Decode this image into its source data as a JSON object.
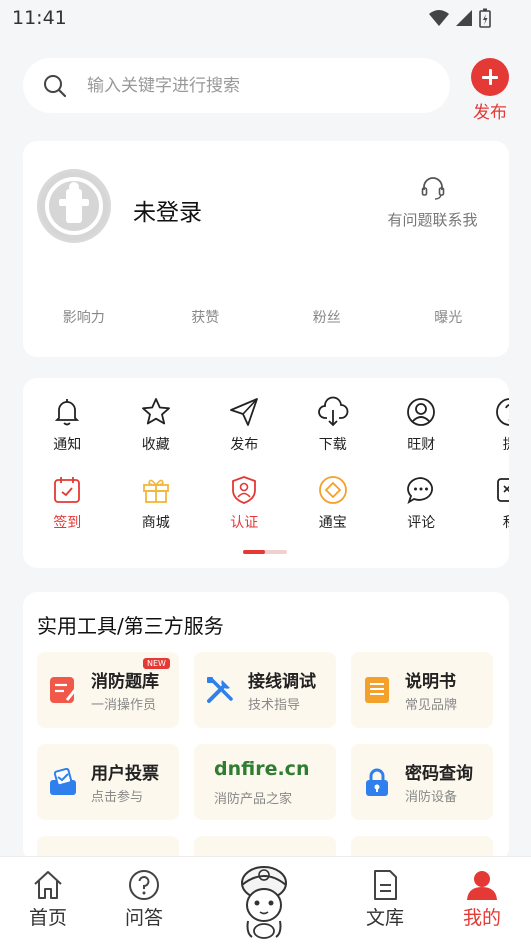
{
  "status_bar": {
    "time": "11:41"
  },
  "search": {
    "placeholder": "输入关键字进行搜索"
  },
  "publish": {
    "label": "发布"
  },
  "profile": {
    "login_text": "未登录",
    "help_text": "有问题联系我",
    "stats": [
      "影响力",
      "获赞",
      "粉丝",
      "曝光"
    ]
  },
  "features": {
    "row1": [
      {
        "label": "通知",
        "icon": "bell-icon"
      },
      {
        "label": "收藏",
        "icon": "star-icon"
      },
      {
        "label": "发布",
        "icon": "send-icon"
      },
      {
        "label": "下载",
        "icon": "cloud-download-icon"
      },
      {
        "label": "旺财",
        "icon": "user-circle-icon"
      },
      {
        "label": "提",
        "icon": "question-icon"
      }
    ],
    "row2": [
      {
        "label": "签到",
        "icon": "calendar-check-icon"
      },
      {
        "label": "商城",
        "icon": "gift-icon"
      },
      {
        "label": "认证",
        "icon": "shield-user-icon"
      },
      {
        "label": "通宝",
        "icon": "coin-icon"
      },
      {
        "label": "评论",
        "icon": "comment-icon"
      },
      {
        "label": "私",
        "icon": "message-icon"
      }
    ]
  },
  "tools": {
    "title": "实用工具/第三方服务",
    "new_badge": "NEW",
    "items": [
      {
        "title": "消防题库",
        "subtitle": "一消操作员",
        "icon": "quiz-icon"
      },
      {
        "title": "接线调试",
        "subtitle": "技术指导",
        "icon": "tools-icon"
      },
      {
        "title": "说明书",
        "subtitle": "常见品牌",
        "icon": "manual-icon"
      },
      {
        "title": "用户投票",
        "subtitle": "点击参与",
        "icon": "vote-icon"
      },
      {
        "title": "dnfire.cn",
        "subtitle": "消防产品之家",
        "icon": "dnfire-logo"
      },
      {
        "title": "密码查询",
        "subtitle": "消防设备",
        "icon": "lock-icon"
      }
    ]
  },
  "bottom_nav": {
    "home": "首页",
    "qa": "问答",
    "library": "文库",
    "mine": "我的"
  },
  "colors": {
    "accent": "#e53935"
  }
}
